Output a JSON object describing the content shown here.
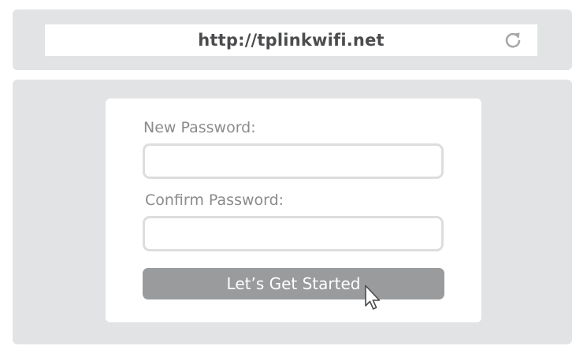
{
  "browser": {
    "url": "http://tplinkwifi.net",
    "refresh_icon": "refresh-icon"
  },
  "form": {
    "new_password_label": "New Password:",
    "new_password_value": "",
    "confirm_password_label": "Confirm Password:",
    "confirm_password_value": "",
    "submit_label": "Let’s Get Started"
  },
  "pointer": {
    "icon": "mouse-pointer-icon"
  },
  "colors": {
    "panel_background": "#e2e3e4",
    "card_background": "#ffffff",
    "url_text": "#4b4c4e",
    "label_text": "#8a8b8d",
    "field_border": "#dcdddf",
    "button_background": "#9a9b9d",
    "button_text": "#ffffff"
  }
}
